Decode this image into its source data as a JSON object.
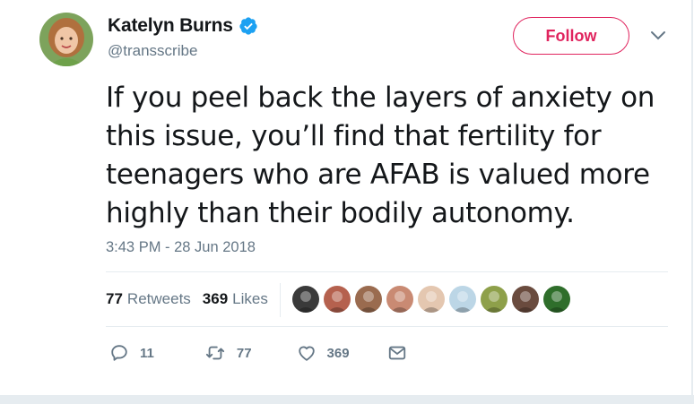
{
  "user": {
    "display_name": "Katelyn Burns",
    "handle": "@transscribe",
    "verified": true,
    "avatar_icon": "avatar-photo-icon"
  },
  "follow_label": "Follow",
  "tweet": {
    "text_lines": [
      "If you peel back the layers of anxiety on",
      "this issue, you’ll find that fertility for",
      "teenagers who are AFAB is valued more",
      "highly than their bodily autonomy."
    ],
    "timestamp": "3:43 PM - 28 Jun 2018"
  },
  "stats": {
    "retweets_count": "77",
    "retweets_label": "Retweets",
    "likes_count": "369",
    "likes_label": "Likes"
  },
  "likers": [
    {
      "icon": "liker-avatar-icon",
      "color": "#3a3a3a"
    },
    {
      "icon": "liker-avatar-icon",
      "color": "#b5614e"
    },
    {
      "icon": "liker-avatar-icon",
      "color": "#9a6b4f"
    },
    {
      "icon": "liker-avatar-icon",
      "color": "#c98a73"
    },
    {
      "icon": "liker-avatar-icon",
      "color": "#e4c7b0"
    },
    {
      "icon": "liker-avatar-icon",
      "color": "#bcd6e6"
    },
    {
      "icon": "liker-avatar-icon",
      "color": "#8ea04a"
    },
    {
      "icon": "liker-avatar-icon",
      "color": "#6a4b3e"
    },
    {
      "icon": "liker-avatar-icon",
      "color": "#2f6e2b"
    }
  ],
  "actions": {
    "reply_count": "11",
    "retweet_count": "77",
    "like_count": "369"
  },
  "colors": {
    "follow_accent": "#e0245e",
    "verified_blue": "#1da1f2",
    "secondary_text": "#657786"
  }
}
